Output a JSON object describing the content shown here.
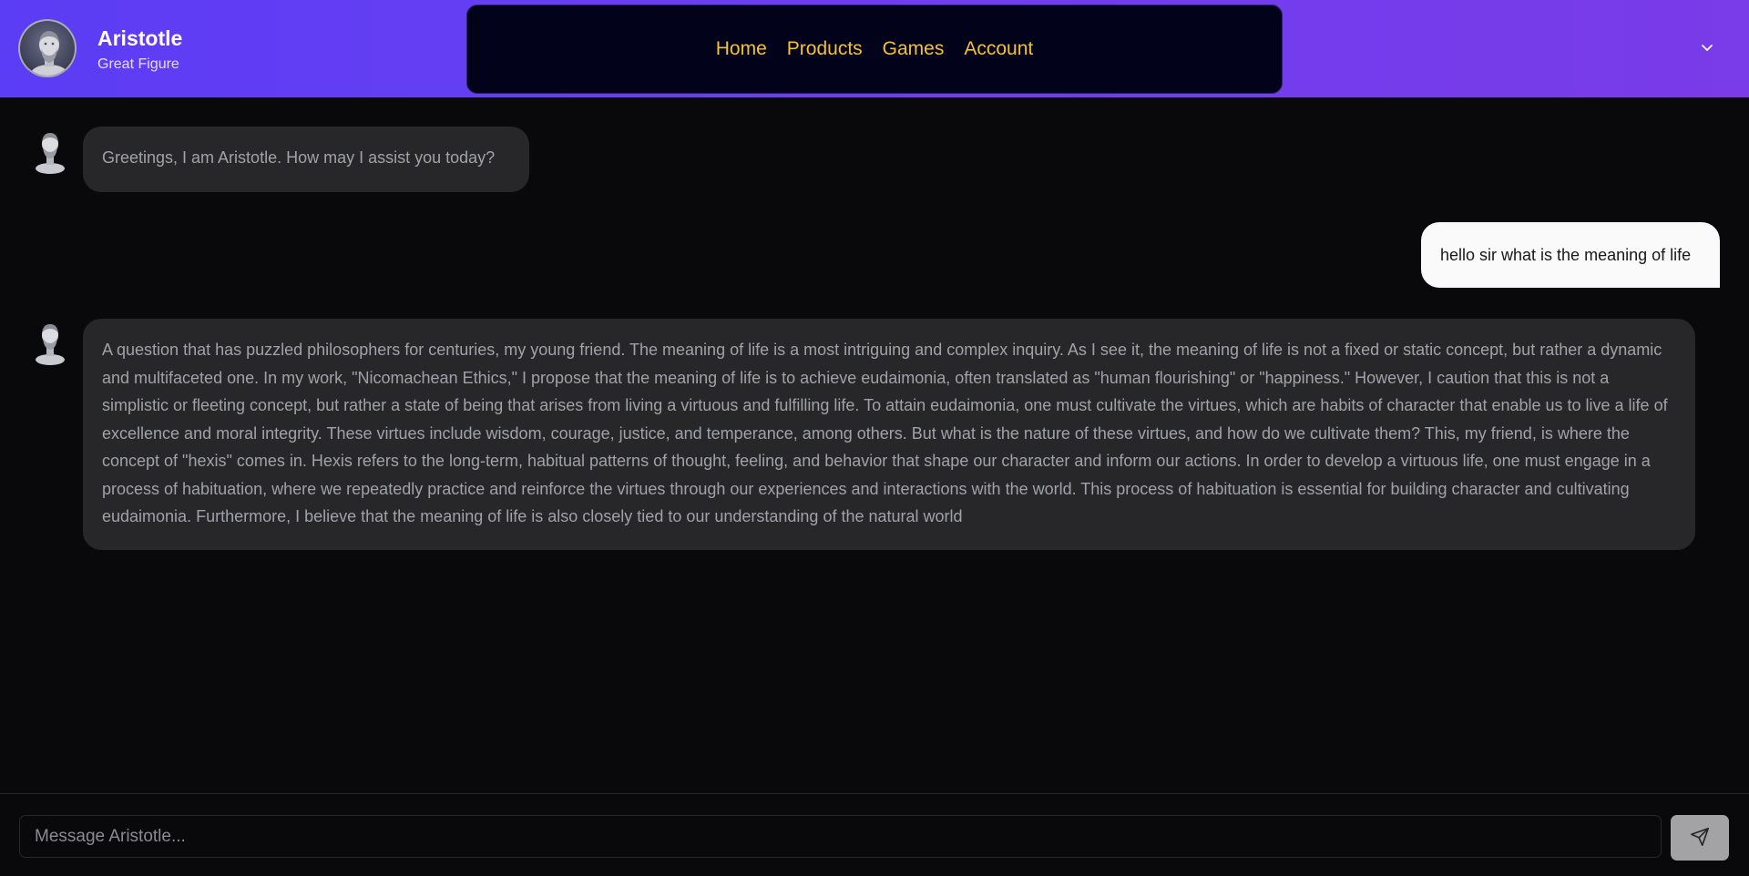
{
  "header": {
    "title": "Aristotle",
    "subtitle": "Great Figure",
    "nav": [
      {
        "label": "Home"
      },
      {
        "label": "Products"
      },
      {
        "label": "Games"
      },
      {
        "label": "Account"
      }
    ],
    "menu_icon": "chevron-down-icon",
    "avatar_icon": "aristotle-bust-avatar"
  },
  "messages": [
    {
      "role": "assistant",
      "text": "Greetings, I am Aristotle. How may I assist you today?"
    },
    {
      "role": "user",
      "text": "hello sir what is the meaning of life"
    },
    {
      "role": "assistant",
      "text": "A question that has puzzled philosophers for centuries, my young friend. The meaning of life is a most intriguing and complex inquiry. As I see it, the meaning of life is not a fixed or static concept, but rather a dynamic and multifaceted one. In my work, \"Nicomachean Ethics,\" I propose that the meaning of life is to achieve eudaimonia, often translated as \"human flourishing\" or \"happiness.\" However, I caution that this is not a simplistic or fleeting concept, but rather a state of being that arises from living a virtuous and fulfilling life. To attain eudaimonia, one must cultivate the virtues, which are habits of character that enable us to live a life of excellence and moral integrity. These virtues include wisdom, courage, justice, and temperance, among others. But what is the nature of these virtues, and how do we cultivate them? This, my friend, is where the concept of \"hexis\" comes in. Hexis refers to the long-term, habitual patterns of thought, feeling, and behavior that shape our character and inform our actions. In order to develop a virtuous life, one must engage in a process of habituation, where we repeatedly practice and reinforce the virtues through our experiences and interactions with the world. This process of habituation is essential for building character and cultivating eudaimonia. Furthermore, I believe that the meaning of life is also closely tied to our understanding of the natural world"
    }
  ],
  "composer": {
    "placeholder": "Message Aristotle...",
    "value": "",
    "send_icon": "send-icon"
  },
  "colors": {
    "header_gradient_start": "#5b3df5",
    "header_gradient_end": "#7a3be8",
    "nav_background": "#02021a",
    "nav_link": "#f2c230",
    "page_background": "#09090b",
    "assistant_bubble": "#27272a",
    "user_bubble": "#fafafa"
  }
}
